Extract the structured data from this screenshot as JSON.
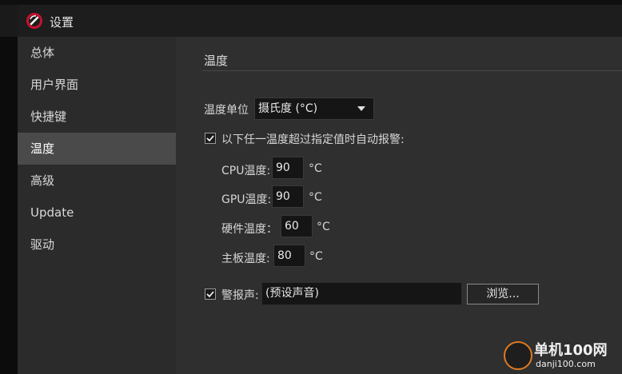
{
  "window": {
    "title": "设置"
  },
  "sidebar": {
    "items": [
      {
        "label": "总体",
        "active": false
      },
      {
        "label": "用户界面",
        "active": false
      },
      {
        "label": "快捷键",
        "active": false
      },
      {
        "label": "温度",
        "active": true
      },
      {
        "label": "高级",
        "active": false
      },
      {
        "label": "Update",
        "active": false
      },
      {
        "label": "驱动",
        "active": false
      }
    ]
  },
  "main": {
    "section_title": "温度",
    "unit": {
      "label": "温度单位",
      "value": "摄氏度 (°C)"
    },
    "alarm": {
      "checked": true,
      "label": "以下任一温度超过指定值时自动报警:",
      "fields": [
        {
          "label": "CPU温度:",
          "value": "90",
          "unit": "°C"
        },
        {
          "label": "GPU温度:",
          "value": "90",
          "unit": "°C"
        },
        {
          "label": "硬件温度：",
          "value": "60",
          "unit": "°C"
        },
        {
          "label": "主板温度:",
          "value": "80",
          "unit": "°C"
        }
      ]
    },
    "sound": {
      "checked": true,
      "label": "警报声:",
      "value": "(预设声音)",
      "browse_label": "浏览..."
    }
  },
  "watermark": {
    "cn": "单机100网",
    "en": "danji100.com"
  },
  "colors": {
    "accent": "#e07a1f",
    "active_item": "#4a4a4a"
  }
}
